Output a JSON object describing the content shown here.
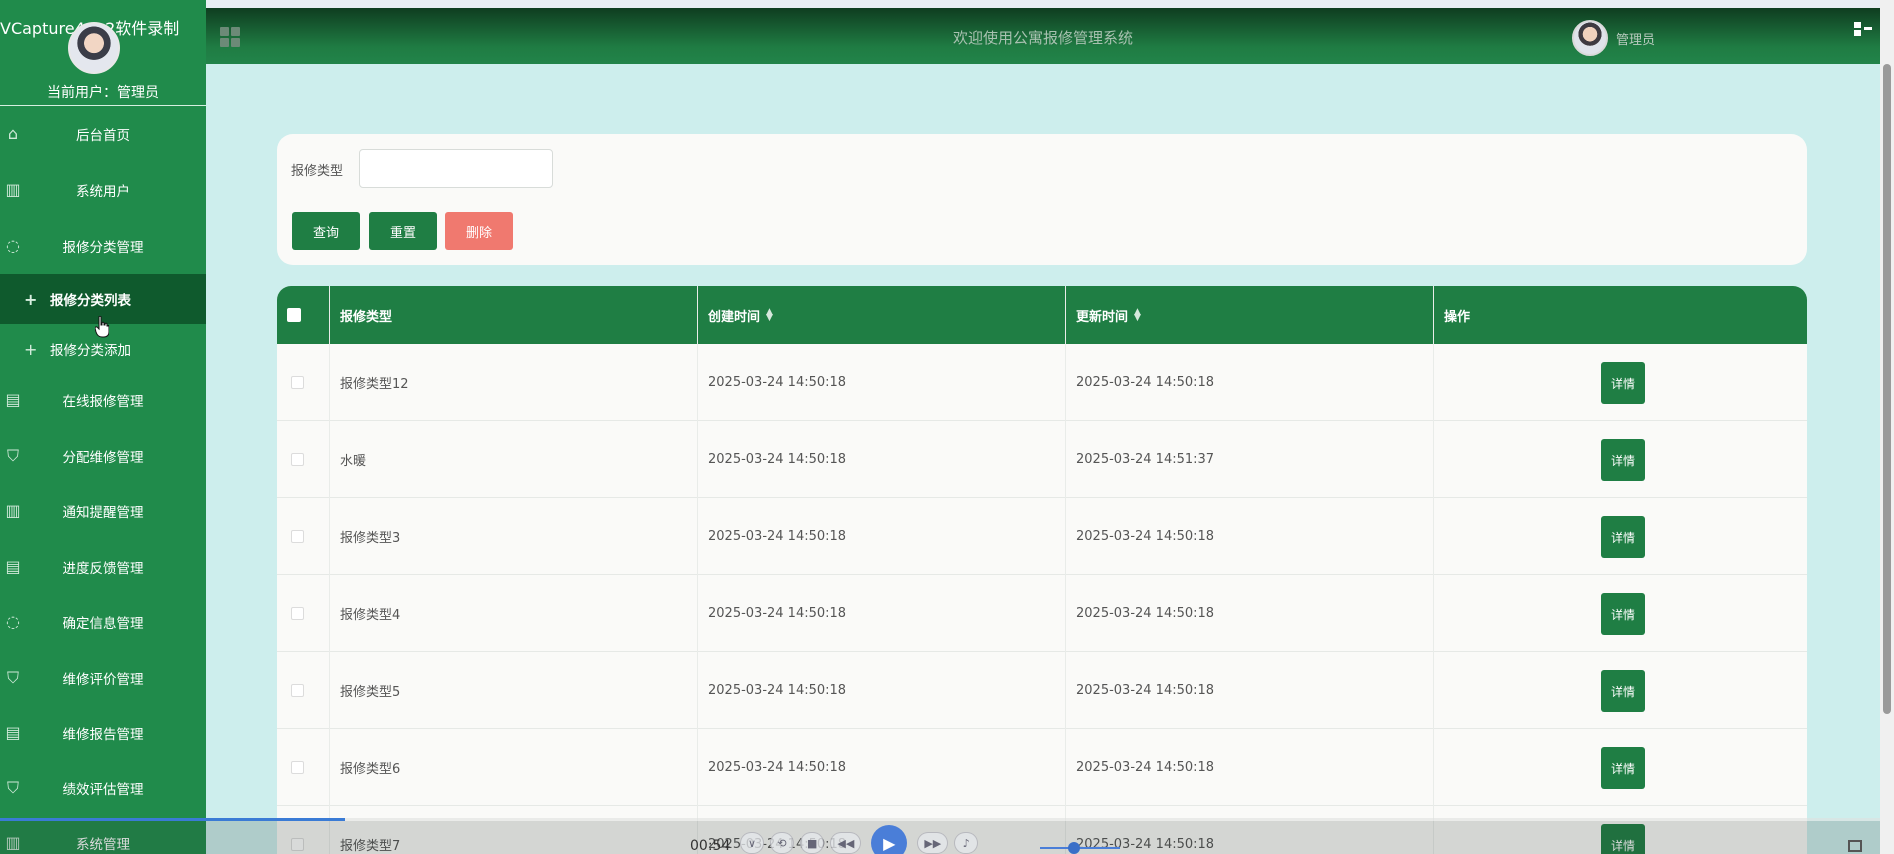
{
  "recorder": {
    "watermark": "VCapture4.0.2软件录制",
    "time": "00:54"
  },
  "header": {
    "title": "欢迎使用公寓报修管理系统",
    "user_name": "管理员"
  },
  "sidebar": {
    "current_user_label": "当前用户：",
    "current_user_name": "管理员",
    "items": [
      {
        "label": "后台首页",
        "icon": "home-icon"
      },
      {
        "label": "系统用户",
        "icon": "columns-icon"
      },
      {
        "label": "报修分类管理",
        "icon": "chat-icon"
      },
      {
        "label": "在线报修管理",
        "icon": "document-icon"
      },
      {
        "label": "分配维修管理",
        "icon": "shield-icon"
      },
      {
        "label": "通知提醒管理",
        "icon": "columns-icon"
      },
      {
        "label": "进度反馈管理",
        "icon": "document-icon"
      },
      {
        "label": "确定信息管理",
        "icon": "chat-icon"
      },
      {
        "label": "维修评价管理",
        "icon": "shield-icon"
      },
      {
        "label": "维修报告管理",
        "icon": "document-icon"
      },
      {
        "label": "绩效评估管理",
        "icon": "shield-icon"
      },
      {
        "label": "系统管理",
        "icon": "columns-icon"
      }
    ],
    "subitems": [
      {
        "label": "报修分类列表",
        "active": true
      },
      {
        "label": "报修分类添加",
        "active": false
      }
    ]
  },
  "filter": {
    "label": "报修类型",
    "input_value": "",
    "query_label": "查询",
    "reset_label": "重置",
    "delete_label": "删除"
  },
  "table": {
    "columns": [
      "报修类型",
      "创建时间",
      "更新时间",
      "操作"
    ],
    "action_label": "详情",
    "rows": [
      {
        "type": "报修类型12",
        "created": "2025-03-24 14:50:18",
        "updated": "2025-03-24 14:50:18"
      },
      {
        "type": "水暖",
        "created": "2025-03-24 14:50:18",
        "updated": "2025-03-24 14:51:37"
      },
      {
        "type": "报修类型3",
        "created": "2025-03-24 14:50:18",
        "updated": "2025-03-24 14:50:18"
      },
      {
        "type": "报修类型4",
        "created": "2025-03-24 14:50:18",
        "updated": "2025-03-24 14:50:18"
      },
      {
        "type": "报修类型5",
        "created": "2025-03-24 14:50:18",
        "updated": "2025-03-24 14:50:18"
      },
      {
        "type": "报修类型6",
        "created": "2025-03-24 14:50:18",
        "updated": "2025-03-24 14:50:18"
      },
      {
        "type": "报修类型7",
        "created": "2025-03-24 14:50:18",
        "updated": "2025-03-24 14:50:18"
      }
    ]
  },
  "colors": {
    "primary": "#1f7e44",
    "sidebar": "#208b4b",
    "danger": "#f0796f",
    "background": "#cdeeed"
  }
}
